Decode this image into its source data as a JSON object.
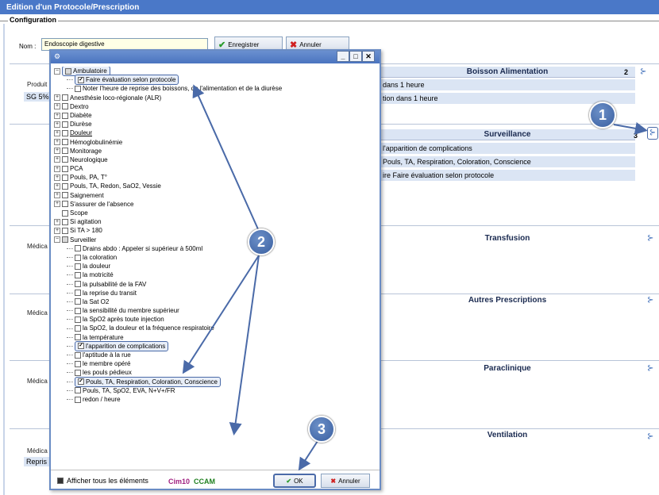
{
  "window": {
    "title": "Edition d'un Protocole/Prescription"
  },
  "config": {
    "label": "Configuration",
    "nom_label": "Nom :",
    "nom_value": "Endoscopie digestive",
    "save": "Enregistrer",
    "cancel": "Annuler"
  },
  "sections": [
    {
      "title": "Boisson Alimentation",
      "count": "2",
      "left_label": "Produit",
      "left_value": "SG 5%",
      "lines": [
        "dans 1 heure",
        "tion dans 1 heure"
      ]
    },
    {
      "title": "Surveillance",
      "count": "3",
      "lines": [
        "l'apparition de complications",
        "Pouls, TA, Respiration, Coloration, Conscience",
        "ire Faire évaluation selon protocole"
      ]
    },
    {
      "title": "Transfusion",
      "left_label": "Médica"
    },
    {
      "title": "Autres Prescriptions",
      "left_label": "Médica"
    },
    {
      "title": "Paraclinique",
      "left_label": "Médica"
    },
    {
      "title": "Ventilation",
      "left_label": "Médica",
      "left_value": "Repris"
    }
  ],
  "dialog": {
    "items": [
      {
        "text": "Ambulatoire",
        "level": 0,
        "exp": "−",
        "state": "part",
        "hl": true
      },
      {
        "text": "Faire évaluation selon protocole",
        "level": 1,
        "state": "on",
        "hl": true
      },
      {
        "text": "Noter l'heure de reprise des boissons, de l'alimentation et de la diurèse",
        "level": 1,
        "state": "off"
      },
      {
        "text": "Anesthésie loco-régionale (ALR)",
        "level": 0,
        "exp": "+",
        "state": "off"
      },
      {
        "text": "Dextro",
        "level": 0,
        "exp": "+",
        "state": "off"
      },
      {
        "text": "Diabète",
        "level": 0,
        "exp": "+",
        "state": "off"
      },
      {
        "text": "Diurèse",
        "level": 0,
        "exp": "+",
        "state": "off"
      },
      {
        "text": "Douleur",
        "level": 0,
        "exp": "+",
        "state": "off",
        "underline": true
      },
      {
        "text": "Hémoglobulinémie",
        "level": 0,
        "exp": "+",
        "state": "off"
      },
      {
        "text": "Monitorage",
        "level": 0,
        "exp": "+",
        "state": "off"
      },
      {
        "text": "Neurologique",
        "level": 0,
        "exp": "+",
        "state": "off"
      },
      {
        "text": "PCA",
        "level": 0,
        "exp": "+",
        "state": "off"
      },
      {
        "text": "Pouls, PA, T°",
        "level": 0,
        "exp": "+",
        "state": "off"
      },
      {
        "text": "Pouls, TA, Redon, SaO2, Vessie",
        "level": 0,
        "exp": "+",
        "state": "off"
      },
      {
        "text": "Saignement",
        "level": 0,
        "exp": "+",
        "state": "off"
      },
      {
        "text": "S'assurer de l'absence",
        "level": 0,
        "exp": "+",
        "state": "off"
      },
      {
        "text": "Scope",
        "level": 0,
        "state": "off"
      },
      {
        "text": "Si agitation",
        "level": 0,
        "exp": "+",
        "state": "off"
      },
      {
        "text": "Si TA > 180",
        "level": 0,
        "exp": "+",
        "state": "off"
      },
      {
        "text": "Surveiller",
        "level": 0,
        "exp": "−",
        "state": "part"
      },
      {
        "text": "Drains abdo : Appeler si supérieur à 500ml",
        "level": 1,
        "state": "off"
      },
      {
        "text": "la coloration",
        "level": 1,
        "state": "off"
      },
      {
        "text": "la douleur",
        "level": 1,
        "state": "off"
      },
      {
        "text": "la motricité",
        "level": 1,
        "state": "off"
      },
      {
        "text": "la pulsabilité de la FAV",
        "level": 1,
        "state": "off"
      },
      {
        "text": "la reprise du transit",
        "level": 1,
        "state": "off"
      },
      {
        "text": "la Sat O2",
        "level": 1,
        "state": "off"
      },
      {
        "text": "la sensibilité du membre supérieur",
        "level": 1,
        "state": "off"
      },
      {
        "text": "la SpO2 après toute injection",
        "level": 1,
        "state": "off"
      },
      {
        "text": "la SpO2, la douleur et la fréquence respiratoire",
        "level": 1,
        "state": "off"
      },
      {
        "text": "la température",
        "level": 1,
        "state": "off"
      },
      {
        "text": "l'apparition de complications",
        "level": 1,
        "state": "on",
        "hl": true
      },
      {
        "text": "l'aptitude à la rue",
        "level": 1,
        "state": "off"
      },
      {
        "text": "le membre opéré",
        "level": 1,
        "state": "off"
      },
      {
        "text": "les pouls pédieux",
        "level": 1,
        "state": "off"
      },
      {
        "text": "Pouls, TA, Respiration, Coloration, Conscience",
        "level": 1,
        "state": "on",
        "hl": true
      },
      {
        "text": "Pouls, TA, SpO2, EVA, N+V+/FR",
        "level": 1,
        "state": "off"
      },
      {
        "text": "redon / heure",
        "level": 1,
        "state": "off"
      }
    ],
    "show_all": "Afficher tous les éléments",
    "cim": "Cim10",
    "ccam": "CCAM",
    "ok": "OK",
    "cancel": "Annuler"
  },
  "callouts": [
    "1",
    "2",
    "3"
  ],
  "colors": {
    "accent": "#4a6aa8",
    "callout": "#3a5fa0",
    "ok": "#2a9a2a",
    "cancel": "#d02020"
  }
}
